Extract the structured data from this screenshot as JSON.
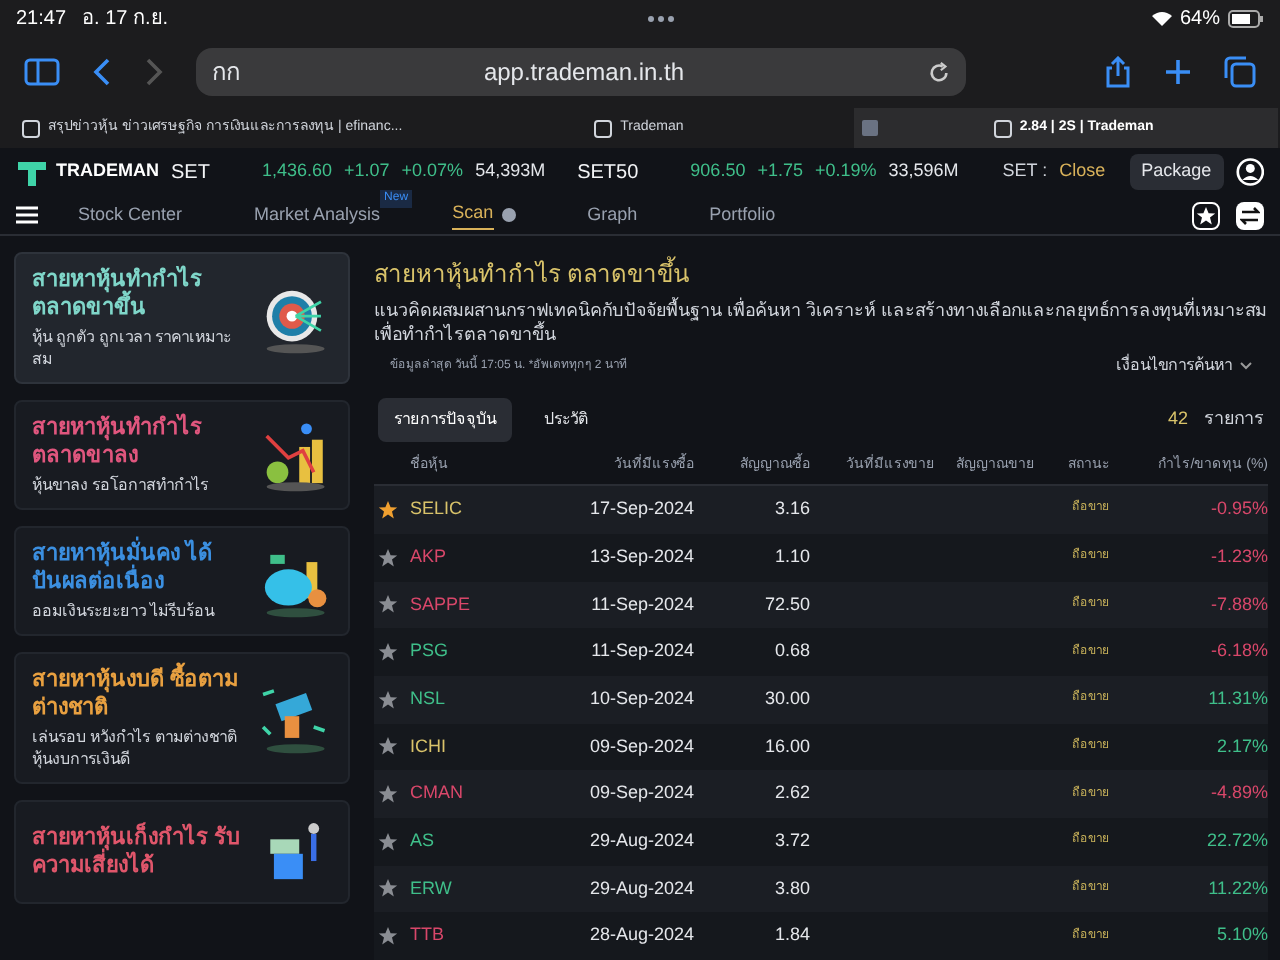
{
  "status_bar": {
    "time": "21:47",
    "date": "อ. 17 ก.ย.",
    "battery": "64%"
  },
  "browser": {
    "text_size": "กก",
    "url": "app.trademan.in.th"
  },
  "browser_tabs": [
    {
      "label": "สรุปข่าวหุ้น ข่าวเศรษฐกิจ การเงินและการลงทุน | efinanc...",
      "selected": false
    },
    {
      "label": "Trademan",
      "selected": false
    },
    {
      "label": "2.84 | 2S | Trademan",
      "selected": true
    }
  ],
  "app": {
    "brand": "TRADEMAN",
    "package": "Package",
    "indices": [
      {
        "name": "SET",
        "value": "1,436.60",
        "change": "+1.07",
        "percent": "+0.07%",
        "volume": "54,393M"
      },
      {
        "name": "SET50",
        "value": "906.50",
        "change": "+1.75",
        "percent": "+0.19%",
        "volume": "33,596M"
      }
    ],
    "market_label": "SET :",
    "market_status": "Close"
  },
  "nav": [
    {
      "label": "Stock Center",
      "selected": false
    },
    {
      "label": "Market Analysis",
      "selected": false,
      "badge": "New"
    },
    {
      "label": "Scan",
      "selected": true,
      "closable": true
    },
    {
      "label": "Graph",
      "selected": false
    },
    {
      "label": "Portfolio",
      "selected": false
    }
  ],
  "sidebar": [
    {
      "title": "สายหาหุ้นทำกำไร ตลาดขาขึ้น",
      "subtitle": "หุ้น ถูกตัว ถูกเวลา ราคาเหมาะสม",
      "color": "#7fd6c9",
      "selected": true,
      "kind": "target"
    },
    {
      "title": "สายหาหุ้นทำกำไร ตลาดขาลง",
      "subtitle": "หุ้นขาลง รอโอกาสทำกำไร",
      "color": "#e0567e",
      "selected": false,
      "kind": "down"
    },
    {
      "title": "สายหาหุ้นมั่นคง ได้ปันผลต่อเนื่อง",
      "subtitle": "ออมเงินระยะยาว ไม่รีบร้อน",
      "color": "#3b8fe0",
      "selected": false,
      "kind": "piggy"
    },
    {
      "title": "สายหาหุ้นงบดี ซื้อตามต่างชาติ",
      "subtitle": "เล่นรอบ หวังกำไร ตามต่างชาติ หุ้นงบการเงินดี",
      "color": "#e8a040",
      "selected": false,
      "kind": "money"
    },
    {
      "title": "สายหาหุ้นเก็งกำไร รับความเสี่ยงได้",
      "color": "#e0566b",
      "selected": false,
      "kind": "risk"
    }
  ],
  "main": {
    "title": "สายหาหุ้นทำกำไร ตลาดขาขึ้น",
    "description": "แนวคิดผสมผสานกราฟเทคนิคกับปัจจัยพื้นฐาน เพื่อค้นหา วิเคราะห์ และสร้างทางเลือกและกลยุทธ์การลงทุนที่เหมาะสม เพื่อทำกำไรตลาดขาขึ้น",
    "updated": "ข้อมูลล่าสุด วันนี้ 17:05 น. *อัพเดททุกๆ 2 นาที",
    "conditions": "เงื่อนไขการค้นหา",
    "tabs": [
      {
        "label": "รายการปัจจุบัน",
        "selected": true
      },
      {
        "label": "ประวัติ",
        "selected": false
      }
    ],
    "count": "42",
    "count_unit": "รายการ"
  },
  "table": {
    "columns": [
      "ชื่อหุ้น",
      "วันที่มีแรงซื้อ",
      "สัญญาณซื้อ",
      "วันที่มีแรงขาย",
      "สัญญาณขาย",
      "สถานะ",
      "กำไร/ขาดทุน (%)"
    ],
    "rows": [
      {
        "starred": true,
        "stock": "SELIC",
        "color": "#d9c36a",
        "buy_date": "17-Sep-2024",
        "buy_signal": "3.16",
        "status": "ถือขาย",
        "profit": {
          "text": "-0.95%",
          "color": "#d9476a"
        }
      },
      {
        "starred": false,
        "stock": "AKP",
        "color": "#d9476a",
        "buy_date": "13-Sep-2024",
        "buy_signal": "1.10",
        "status": "ถือขาย",
        "profit": {
          "text": "-1.23%",
          "color": "#d9476a"
        }
      },
      {
        "starred": false,
        "stock": "SAPPE",
        "color": "#d9476a",
        "buy_date": "11-Sep-2024",
        "buy_signal": "72.50",
        "status": "ถือขาย",
        "profit": {
          "text": "-7.88%",
          "color": "#d9476a"
        }
      },
      {
        "starred": false,
        "stock": "PSG",
        "color": "#3fbf8a",
        "buy_date": "11-Sep-2024",
        "buy_signal": "0.68",
        "status": "ถือขาย",
        "profit": {
          "text": "-6.18%",
          "color": "#d9476a"
        }
      },
      {
        "starred": false,
        "stock": "NSL",
        "color": "#3fbf8a",
        "buy_date": "10-Sep-2024",
        "buy_signal": "30.00",
        "status": "ถือขาย",
        "profit": {
          "text": "11.31%",
          "color": "#3fbf8a"
        }
      },
      {
        "starred": false,
        "stock": "ICHI",
        "color": "#d9c36a",
        "buy_date": "09-Sep-2024",
        "buy_signal": "16.00",
        "status": "ถือขาย",
        "profit": {
          "text": "2.17%",
          "color": "#3fbf8a"
        }
      },
      {
        "starred": false,
        "stock": "CMAN",
        "color": "#d9476a",
        "buy_date": "09-Sep-2024",
        "buy_signal": "2.62",
        "status": "ถือขาย",
        "profit": {
          "text": "-4.89%",
          "color": "#d9476a"
        }
      },
      {
        "starred": false,
        "stock": "AS",
        "color": "#3fbf8a",
        "buy_date": "29-Aug-2024",
        "buy_signal": "3.72",
        "status": "ถือขาย",
        "profit": {
          "text": "22.72%",
          "color": "#3fbf8a"
        }
      },
      {
        "starred": false,
        "stock": "ERW",
        "color": "#3fbf8a",
        "buy_date": "29-Aug-2024",
        "buy_signal": "3.80",
        "status": "ถือขาย",
        "profit": {
          "text": "11.22%",
          "color": "#3fbf8a"
        }
      },
      {
        "starred": false,
        "stock": "TTB",
        "color": "#d9476a",
        "buy_date": "28-Aug-2024",
        "buy_signal": "1.84",
        "status": "ถือขาย",
        "profit": {
          "text": "5.10%",
          "color": "#3fbf8a"
        }
      }
    ]
  }
}
